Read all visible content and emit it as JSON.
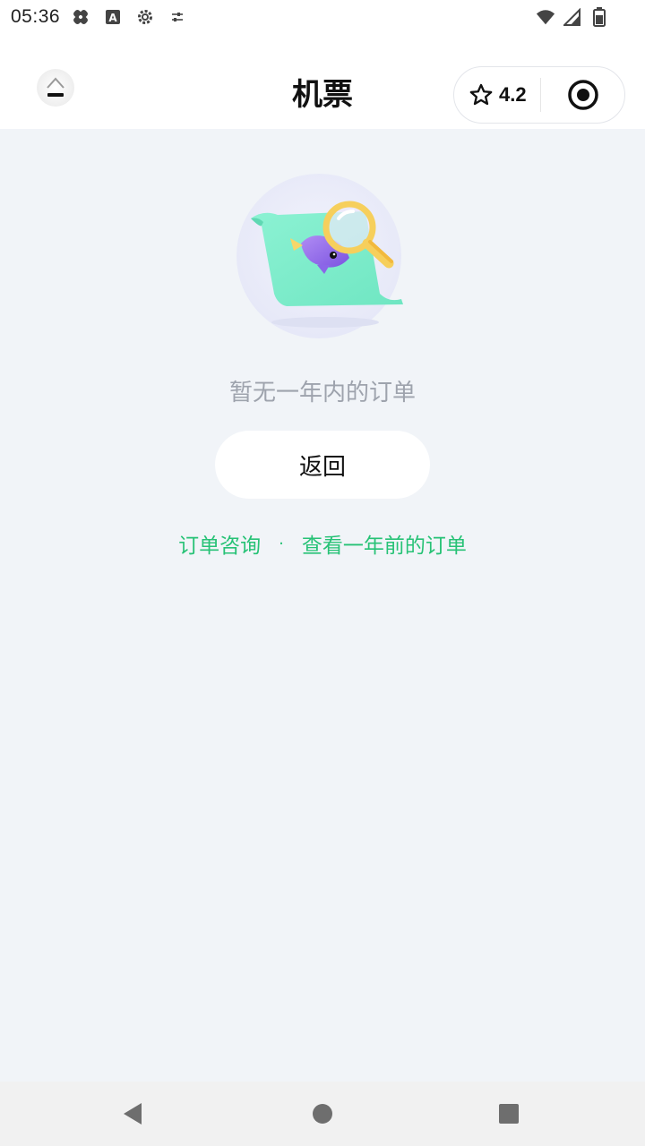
{
  "status_bar": {
    "time": "05:36",
    "left_icons": [
      "health-icon",
      "a-icon",
      "settings-icon",
      "sliders-icon"
    ],
    "right_icons": [
      "wifi-icon",
      "signal-icon",
      "battery-icon"
    ]
  },
  "header": {
    "title": "机票",
    "rating": "4.2"
  },
  "empty_state": {
    "message": "暂无一年内的订单",
    "back_label": "返回"
  },
  "links": {
    "consult": "订单咨询",
    "separator": "·",
    "older_orders": "查看一年前的订单"
  },
  "colors": {
    "accent": "#27c276",
    "background": "#f1f4f8"
  }
}
